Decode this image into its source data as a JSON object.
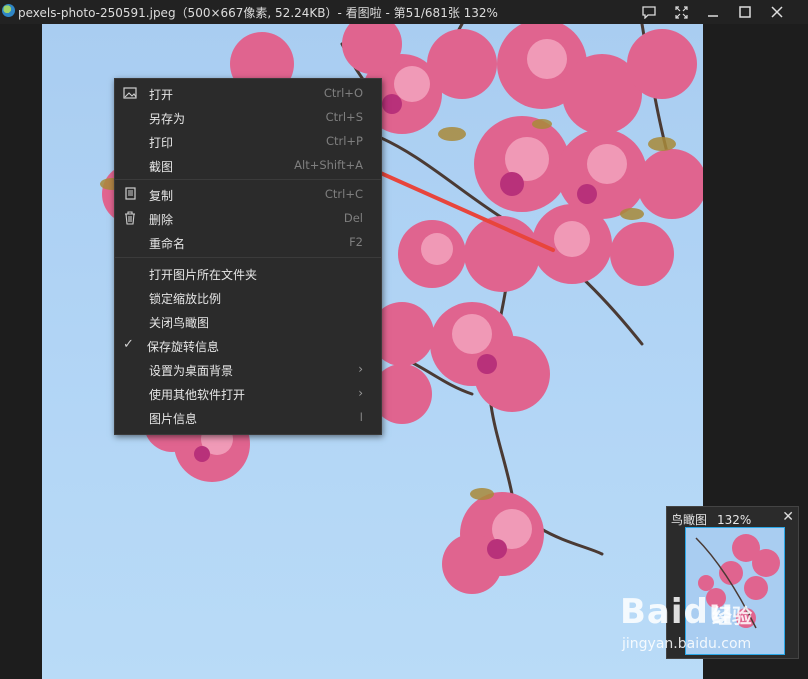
{
  "window": {
    "title": "pexels-photo-250591.jpeg（500×667像素, 52.24KB）- 看图啦 - 第51/681张 132%",
    "buttons": [
      "comment-icon",
      "fullscreen-icon",
      "minimize-icon",
      "maximize-icon",
      "close-icon"
    ]
  },
  "context_menu": {
    "items": [
      {
        "label": "打开",
        "shortcut": "Ctrl+O",
        "icon": "image-icon"
      },
      {
        "label": "另存为",
        "shortcut": "Ctrl+S"
      },
      {
        "label": "打印",
        "shortcut": "Ctrl+P"
      },
      {
        "label": "截图",
        "shortcut": "Alt+Shift+A"
      },
      {
        "label": "复制",
        "shortcut": "Ctrl+C",
        "icon": "copy-icon"
      },
      {
        "label": "删除",
        "shortcut": "Del",
        "icon": "trash-icon"
      },
      {
        "label": "重命名",
        "shortcut": "F2"
      },
      {
        "label": "打开图片所在文件夹"
      },
      {
        "label": "锁定缩放比例"
      },
      {
        "label": "关闭鸟瞰图"
      },
      {
        "label": "保存旋转信息",
        "checked": true
      },
      {
        "label": "设置为桌面背景",
        "submenu": true
      },
      {
        "label": "使用其他软件打开",
        "submenu": true
      },
      {
        "label": "图片信息",
        "shortcut": "I"
      }
    ],
    "submenu_glyph": "›",
    "check_glyph": "✓"
  },
  "birdseye": {
    "title": "鸟瞰图",
    "zoom": "132%",
    "close": "✕"
  },
  "watermark": {
    "brand": "Baidu",
    "sub": "经验",
    "site": "jingyan.baidu.com"
  },
  "colors": {
    "menu_bg": "#2b2b2b",
    "accent_arrow": "#e8453c",
    "sky": "#a9cdf1",
    "blossom": "#e0648f"
  }
}
